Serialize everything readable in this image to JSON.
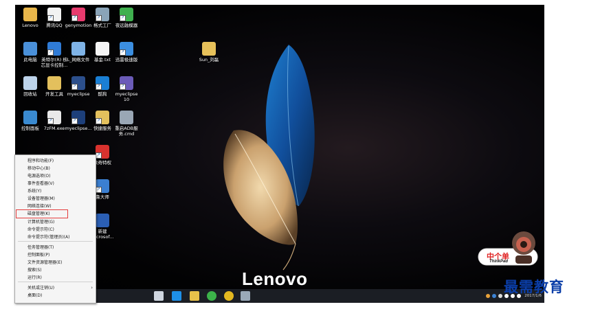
{
  "desktop": {
    "brand": "Lenovo",
    "icons": [
      {
        "name": "icon-lenovo",
        "label": "Lenovo",
        "label2": "",
        "color": "#e8b64a",
        "shortcut": false
      },
      {
        "name": "icon-tencent-qq",
        "label": "腾讯QQ",
        "label2": "",
        "color": "#f2f2f2",
        "shortcut": true
      },
      {
        "name": "icon-genymotion",
        "label": "genymotion",
        "label2": "",
        "color": "#e83b6e",
        "shortcut": true
      },
      {
        "name": "icon-format-factory",
        "label": "格式工厂",
        "label2": "",
        "color": "#8aa4b8",
        "shortcut": true
      },
      {
        "name": "icon-emulator",
        "label": "夜远融模器",
        "label2": "",
        "color": "#3fb04e",
        "shortcut": true
      },
      {
        "name": "icon-this-pc",
        "label": "此电脑",
        "label2": "",
        "color": "#4a90d9",
        "shortcut": false
      },
      {
        "name": "icon-driver-tool",
        "label": "英特尔(R) 核",
        "label2": "芯显卡控制...",
        "color": "#2f7bd6",
        "shortcut": true
      },
      {
        "name": "icon-l-file",
        "label": "L_网络文件",
        "label2": "",
        "color": "#7fb3e6",
        "shortcut": false
      },
      {
        "name": "icon-note-txt",
        "label": "基金.txt",
        "label2": "",
        "color": "#f4f4f4",
        "shortcut": false
      },
      {
        "name": "icon-thunder",
        "label": "迅雷极速版",
        "label2": "",
        "color": "#3b8ee0",
        "shortcut": true
      },
      {
        "name": "icon-sun-folder",
        "label": "Sun_刘磊",
        "label2": "",
        "color": "#e7c15a",
        "shortcut": false
      },
      {
        "name": "icon-recycle-bin",
        "label": "回收站",
        "label2": "",
        "color": "#bcd3ea",
        "shortcut": false
      },
      {
        "name": "icon-dev-tools",
        "label": "开发工具",
        "label2": "",
        "color": "#e3c05d",
        "shortcut": false
      },
      {
        "name": "icon-myeclipse",
        "label": "myeclipse",
        "label2": "",
        "color": "#2c4f8c",
        "shortcut": true
      },
      {
        "name": "icon-kugou",
        "label": "酷狗",
        "label2": "",
        "color": "#1a7fd4",
        "shortcut": true
      },
      {
        "name": "icon-myeclipse-10",
        "label": "myeclipse",
        "label2": "10",
        "color": "#6b5bb8",
        "shortcut": true
      },
      {
        "name": "icon-control-panel",
        "label": "控制面板",
        "label2": "",
        "color": "#3a8ad0",
        "shortcut": false
      },
      {
        "name": "icon-7zfm",
        "label": "7zFM.exe",
        "label2": "",
        "color": "#e9e9e9",
        "shortcut": true
      },
      {
        "name": "icon-myeclipse-me",
        "label": "myeclipse...",
        "label2": "",
        "color": "#1d3f7a",
        "shortcut": true
      },
      {
        "name": "icon-quick-service",
        "label": "快捷服务",
        "label2": "",
        "color": "#e3c05d",
        "shortcut": true
      },
      {
        "name": "icon-restart-adb",
        "label": "重启ADB服",
        "label2": "务.cmd",
        "color": "#9aa7b5",
        "shortcut": false
      },
      {
        "name": "icon-privilege",
        "label": "歌奇特权",
        "label2": "",
        "color": "#d9322e",
        "shortcut": true
      },
      {
        "name": "icon-ludashi",
        "label": "鲁大师",
        "label2": "",
        "color": "#3b7fd1",
        "shortcut": true
      },
      {
        "name": "icon-word-doc",
        "label": "新建",
        "label2": "Microsof...",
        "color": "#2b5fb4",
        "shortcut": false
      }
    ]
  },
  "context_menu": {
    "items": [
      {
        "label": "程序和功能(F)",
        "submenu": false,
        "highlight": false
      },
      {
        "label": "移动中心(B)",
        "submenu": false,
        "highlight": false
      },
      {
        "label": "电源选项(O)",
        "submenu": false,
        "highlight": false
      },
      {
        "label": "事件查看器(V)",
        "submenu": false,
        "highlight": false
      },
      {
        "label": "系统(Y)",
        "submenu": false,
        "highlight": false
      },
      {
        "label": "设备管理器(M)",
        "submenu": false,
        "highlight": false
      },
      {
        "label": "网络连接(W)",
        "submenu": false,
        "highlight": false
      },
      {
        "label": "磁盘管理(K)",
        "submenu": false,
        "highlight": true
      },
      {
        "label": "计算机管理(G)",
        "submenu": false,
        "highlight": false
      },
      {
        "label": "命令提示符(C)",
        "submenu": false,
        "highlight": false
      },
      {
        "label": "命令提示符(管理员)(A)",
        "submenu": false,
        "highlight": false
      },
      {
        "label": "任务管理器(T)",
        "submenu": false,
        "highlight": false
      },
      {
        "label": "控制面板(P)",
        "submenu": false,
        "highlight": false
      },
      {
        "label": "文件资源管理器(E)",
        "submenu": false,
        "highlight": false
      },
      {
        "label": "搜索(S)",
        "submenu": false,
        "highlight": false
      },
      {
        "label": "运行(R)",
        "submenu": false,
        "highlight": false
      },
      {
        "label": "关机或注销(U)",
        "submenu": true,
        "highlight": false
      },
      {
        "label": "桌面(D)",
        "submenu": false,
        "highlight": false
      }
    ]
  },
  "taskbar": {
    "apps": [
      {
        "name": "task-view-icon",
        "color": "#cfd6e0"
      },
      {
        "name": "edge-icon",
        "color": "#1e90e8"
      },
      {
        "name": "file-explorer-icon",
        "color": "#e8c24a"
      },
      {
        "name": "green-app-icon",
        "color": "#3cb24a"
      },
      {
        "name": "yellow-app-icon",
        "color": "#e4b820"
      },
      {
        "name": "format-factory-taskbar-icon",
        "color": "#9aa9b8"
      }
    ],
    "clock": "2017/1/6",
    "tray_colors": [
      "#e8a23a",
      "#3d84d6",
      "#d9d9d9",
      "#ffffff",
      "#ffffff",
      "#ffffff"
    ]
  },
  "overlay": {
    "watermark": "最需教育",
    "mascot_text": "中个单",
    "mascot_sub": "ThinkPad"
  }
}
